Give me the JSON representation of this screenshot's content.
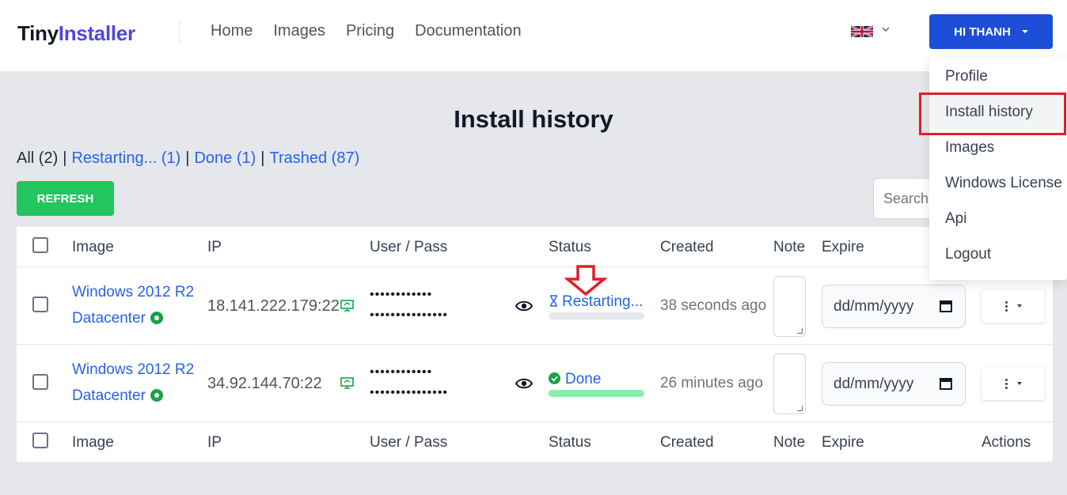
{
  "brand": {
    "part1": "Tiny",
    "part2": "Installer"
  },
  "nav": {
    "items": [
      "Home",
      "Images",
      "Pricing",
      "Documentation"
    ]
  },
  "language": {
    "flag": "uk-flag-icon"
  },
  "user_menu": {
    "button_label": "HI THANH",
    "items": [
      "Profile",
      "Install history",
      "Images",
      "Windows License",
      "Api",
      "Logout"
    ],
    "active_item": "Install history"
  },
  "page": {
    "title": "Install history",
    "filters": {
      "all": "All (2)",
      "restarting": "Restarting... (1)",
      "done": "Done (1)",
      "trashed": "Trashed (87)",
      "separator": "|"
    },
    "refresh_label": "REFRESH",
    "search_placeholder": "Search"
  },
  "table": {
    "columns": [
      "Image",
      "IP",
      "User / Pass",
      "Status",
      "Created",
      "Note",
      "Expire",
      "Actions"
    ],
    "rows": [
      {
        "image_line1": "Windows 2012 R2",
        "image_line2": "Datacenter",
        "ip": "18.141.222.179:22",
        "user_mask": "••••••••••••",
        "pass_mask": "•••••••••••••••",
        "status": "Restarting...",
        "status_icon": "hourglass-icon",
        "progress": 0,
        "created": "38 seconds ago",
        "expire_placeholder": "dd/mm/yyyy"
      },
      {
        "image_line1": "Windows 2012 R2",
        "image_line2": "Datacenter",
        "ip": "34.92.144.70:22",
        "user_mask": "••••••••••••",
        "pass_mask": "•••••••••••••••",
        "status": "Done",
        "status_icon": "check-circle-icon",
        "progress": 1,
        "created": "26 minutes ago",
        "expire_placeholder": "dd/mm/yyyy"
      }
    ]
  },
  "colors": {
    "brand_accent": "#4f46e5",
    "primary": "#1d4ed8",
    "link": "#2563eb",
    "success": "#22c55e",
    "progress_done": "#86efac",
    "annotation_red": "#e11d2a"
  }
}
